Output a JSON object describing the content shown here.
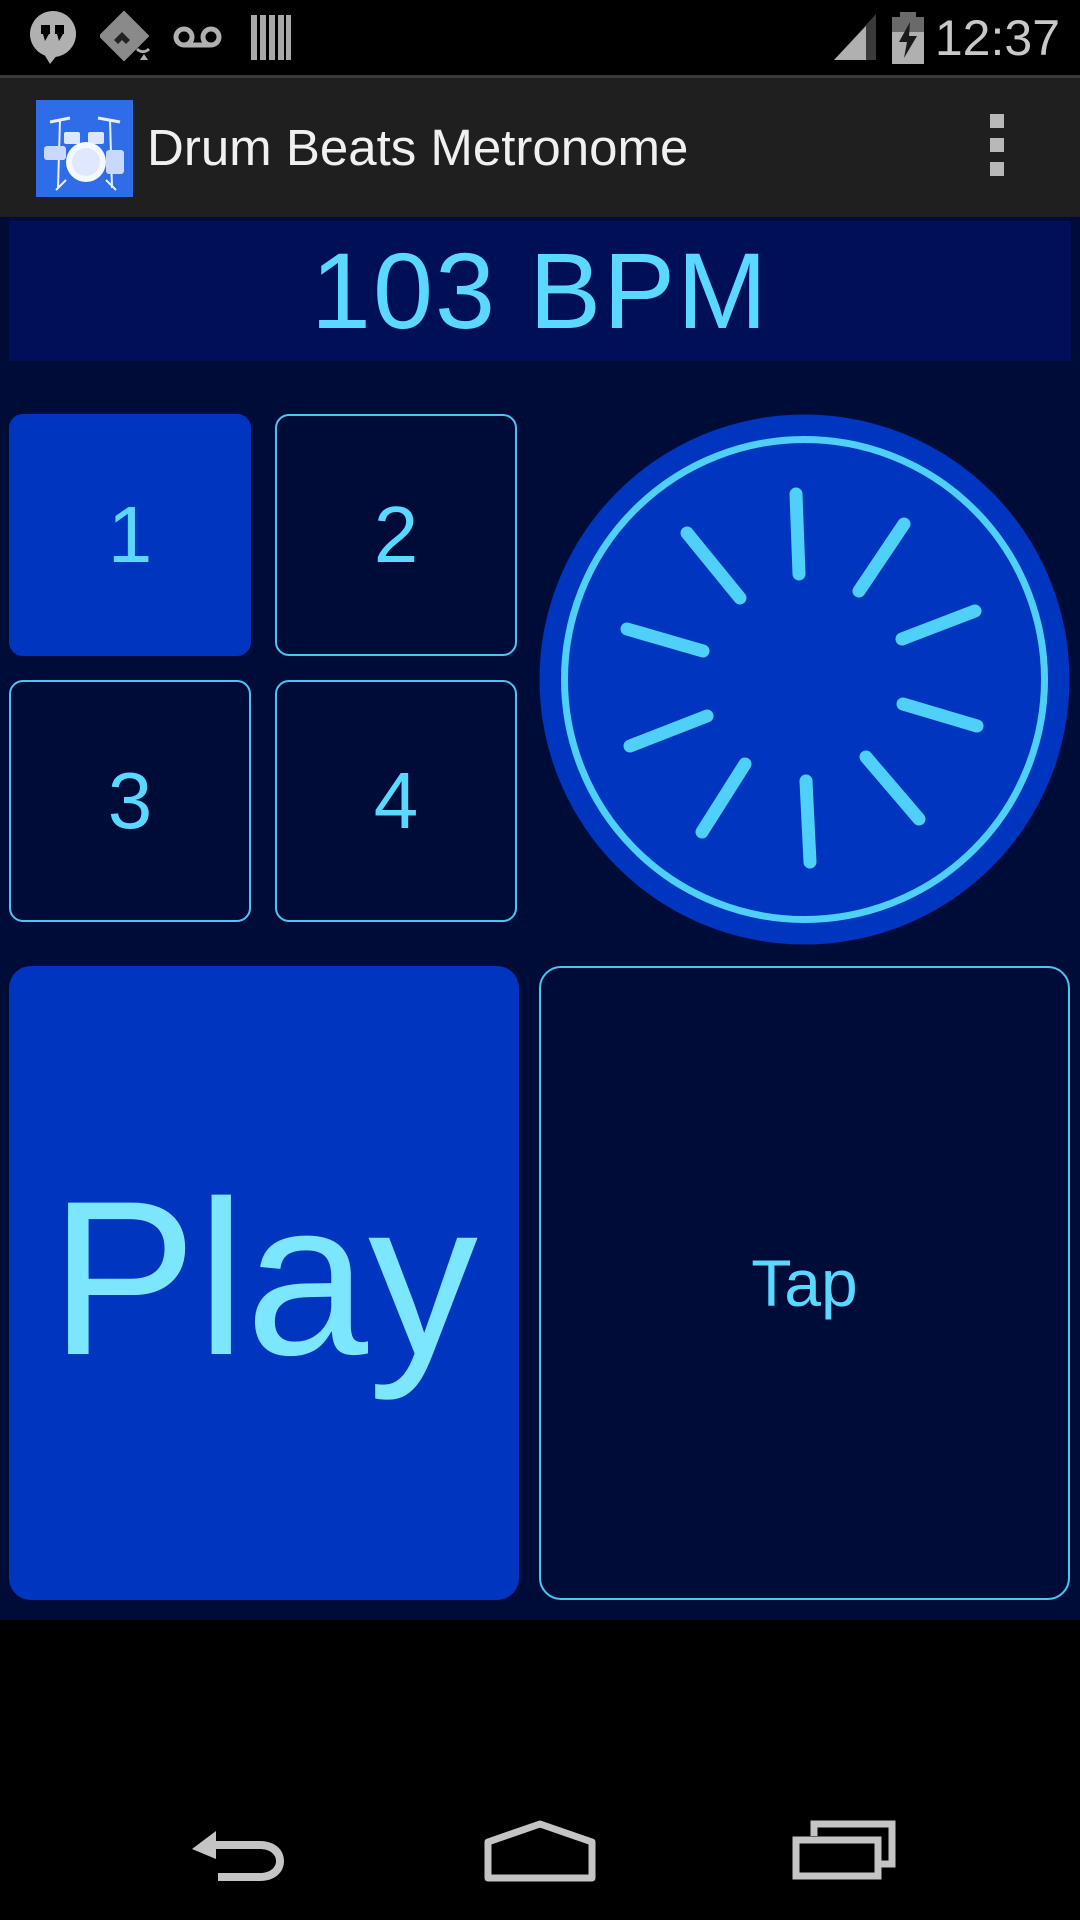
{
  "status_bar": {
    "time": "12:37",
    "icons": [
      "hangouts-icon",
      "photo-sync-icon",
      "voicemail-icon",
      "barcode-icon",
      "cell-signal-icon",
      "battery-charging-icon"
    ]
  },
  "action_bar": {
    "title": "Drum Beats Metronome",
    "app_icon": "drum-kit-icon",
    "menu_icon": "overflow-menu-icon"
  },
  "metronome": {
    "tempo_display": "103 BPM",
    "beats": [
      {
        "label": "1",
        "active": true
      },
      {
        "label": "2",
        "active": false
      },
      {
        "label": "3",
        "active": false
      },
      {
        "label": "4",
        "active": false
      }
    ],
    "dial_icon": "tempo-dial-icon",
    "play_label": "Play",
    "tap_label": "Tap"
  },
  "nav_bar": {
    "icons": [
      "back-icon",
      "home-icon",
      "recent-apps-icon"
    ]
  },
  "colors": {
    "background": "#000c38",
    "accent": "#0035c0",
    "text": "#5ad8ff",
    "outline": "#4cc6f0"
  }
}
